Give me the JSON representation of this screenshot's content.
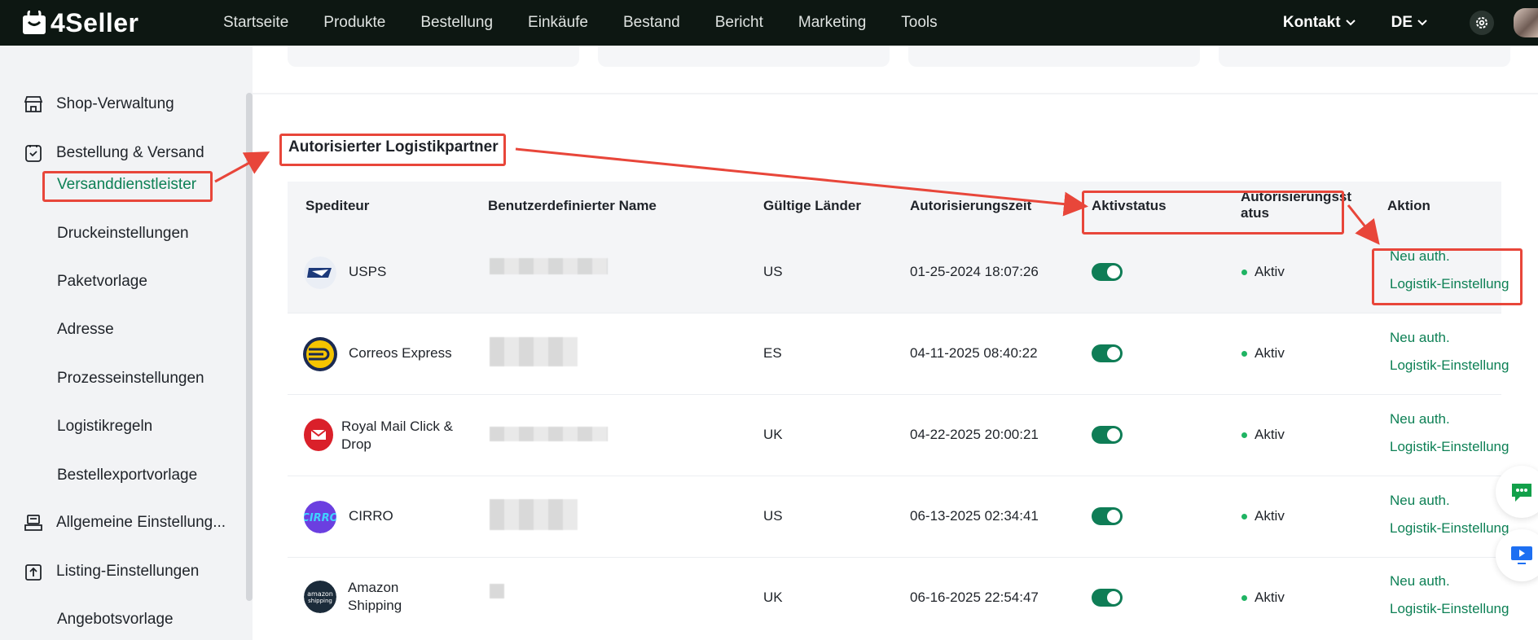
{
  "app": {
    "brand": "4Seller",
    "nav": [
      "Startseite",
      "Produkte",
      "Bestellung",
      "Einkäufe",
      "Bestand",
      "Bericht",
      "Marketing",
      "Tools"
    ],
    "contact": "Kontakt",
    "lang": "DE"
  },
  "sidebar": {
    "shop": "Shop-Verwaltung",
    "order": "Bestellung & Versand",
    "sub": [
      "Versanddienstleister",
      "Druckeinstellungen",
      "Paketvorlage",
      "Adresse",
      "Prozesseinstellungen",
      "Logistikregeln",
      "Bestellexportvorlage"
    ],
    "general": "Allgemeine Einstellung...",
    "listing": "Listing-Einstellungen",
    "offer": "Angebotsvorlage"
  },
  "section": {
    "title": "Autorisierter Logistikpartner"
  },
  "table": {
    "headers": [
      "Spediteur",
      "Benutzerdefinierter Name",
      "Gültige Länder",
      "Autorisierungszeit",
      "Aktivstatus",
      "Autorisierungsst atus",
      "Aktion"
    ],
    "rows": [
      {
        "carrier": "USPS",
        "country": "US",
        "time": "01-25-2024 18:07:26",
        "status": "Aktiv",
        "action1": "Neu auth.",
        "action2": "Logistik-Einstellung"
      },
      {
        "carrier": "Correos Express",
        "country": "ES",
        "time": "04-11-2025 08:40:22",
        "status": "Aktiv",
        "action1": "Neu auth.",
        "action2": "Logistik-Einstellung"
      },
      {
        "carrier": "Royal Mail Click & Drop",
        "country": "UK",
        "time": "04-22-2025 20:00:21",
        "status": "Aktiv",
        "action1": "Neu auth.",
        "action2": "Logistik-Einstellung"
      },
      {
        "carrier": "CIRRO",
        "country": "US",
        "time": "06-13-2025 02:34:41",
        "status": "Aktiv",
        "action1": "Neu auth.",
        "action2": "Logistik-Einstellung"
      },
      {
        "carrier": "Amazon Shipping",
        "country": "UK",
        "time": "06-16-2025 22:54:47",
        "status": "Aktiv",
        "action1": "Neu auth.",
        "action2": "Logistik-Einstellung"
      }
    ]
  },
  "colors": {
    "accent": "#0d8055",
    "topbar": "#0d1712",
    "annotation": "#e8463a",
    "status_dot": "#1fb463"
  }
}
